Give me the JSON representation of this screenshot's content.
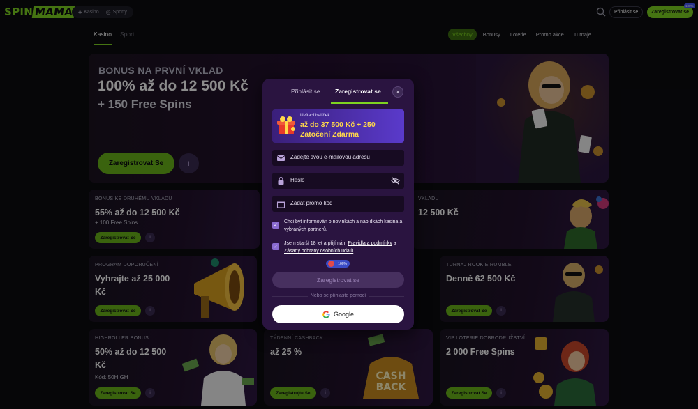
{
  "header": {
    "logo_left": "SPIN",
    "logo_right": "MAMA",
    "nav": [
      "Kasino",
      "Sporty"
    ],
    "login": "Přihlásit se",
    "register": "Zaregistrovat se",
    "register_badge": "100%"
  },
  "subnav": {
    "left": [
      "Kasino",
      "Sport"
    ],
    "right": [
      "Všechny",
      "Bonusy",
      "Loterie",
      "Promo akce",
      "Turnaje"
    ]
  },
  "hero": {
    "line1": "BONUS NA PRVNÍ VKLAD",
    "line2": "100% až do 12 500 Kč",
    "line3": "+ 150 Free Spins",
    "cta": "Zaregistrovat Se",
    "info": "i"
  },
  "cards": [
    {
      "title": "BONUS KE DRUHÉMU VKLADU",
      "value": "55% až do 12 500 Kč",
      "sub": "+ 100 Free Spins",
      "cta": "Zaregistrovat Se"
    },
    {
      "title": "VKLADU",
      "value": "12 500 Kč",
      "sub": "",
      "cta": ""
    },
    {
      "title": "PROGRAM DOPORUČENÍ",
      "value": "Vyhrajte až 25 000 Kč",
      "sub": "",
      "cta": "Zaregistrovat Se"
    },
    {
      "title": "TURNAJ ROOKIE RUMBLE",
      "value": "Denně 62 500 Kč",
      "sub": "",
      "cta": "Zaregistrovat Se"
    },
    {
      "title": "HIGHROLLER BONUS",
      "value": "50% až do 12 500 Kč",
      "sub": "Kód: 50HIGH",
      "cta": "Zaregistrovat Se"
    },
    {
      "title": "TÝDENNÍ CASHBACK",
      "value": "až 25 %",
      "sub": "",
      "cta": "Zaregistrujte Se"
    },
    {
      "title": "VIP LOTERIE DOBRODRUŽSTVÍ",
      "value": "2 000 Free Spins",
      "sub": "",
      "cta": "Zaregistrovat Se"
    }
  ],
  "modal": {
    "tab_login": "Přihlásit se",
    "tab_register": "Zaregistrovat se",
    "close": "×",
    "welcome_label": "Uvítací balíček",
    "welcome_offer": "až do 37 500 Kč + 250 Zatočení Zdarma",
    "email_placeholder": "Zadejte svou e-mailovou adresu",
    "password_placeholder": "Heslo",
    "promo_placeholder": "Zadat promo kód",
    "consent_news": "Chci být informován o novinkách a nabídkách kasina a vybraných partnerů.",
    "consent_age_prefix": "Jsem starší 18 let a přijímám ",
    "consent_terms_link": "Pravidla a podmínky",
    "consent_and": " a ",
    "consent_privacy_link": "Zásady ochrany osobních údajů",
    "progress_label": "100%",
    "register_button": "Zaregistrovat se",
    "or_text": "Nebo se přihlaste pomocí",
    "google_button": "Google"
  },
  "colors": {
    "accent": "#7ed321",
    "modal_bg": "#2a1440",
    "banner_gold": "#ffd84a"
  }
}
